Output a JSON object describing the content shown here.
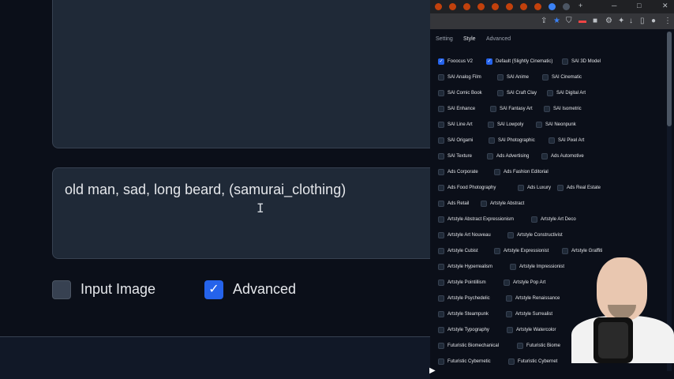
{
  "app": {
    "prompt_text": "old man, sad, long beard, (samurai_clothing)",
    "checkbox_input_image_label": "Input Image",
    "checkbox_advanced_label": "Advanced",
    "checkbox_input_image_checked": false,
    "checkbox_advanced_checked": true
  },
  "settings_tabs": [
    {
      "label": "Setting",
      "active": false
    },
    {
      "label": "Style",
      "active": true
    },
    {
      "label": "Advanced",
      "active": false
    }
  ],
  "styles": [
    {
      "label": "Fooocus V2",
      "checked": true
    },
    {
      "label": "Default (Slightly Cinematic)",
      "checked": true
    },
    {
      "label": "SAI 3D Model",
      "checked": false
    },
    {
      "label": "SAI Analog Film",
      "checked": false
    },
    {
      "label": "SAI Anime",
      "checked": false
    },
    {
      "label": "SAI Cinematic",
      "checked": false
    },
    {
      "label": "SAI Comic Book",
      "checked": false
    },
    {
      "label": "SAI Craft Clay",
      "checked": false
    },
    {
      "label": "SAI Digital Art",
      "checked": false
    },
    {
      "label": "SAI Enhance",
      "checked": false
    },
    {
      "label": "SAI Fantasy Art",
      "checked": false
    },
    {
      "label": "SAI Isometric",
      "checked": false
    },
    {
      "label": "SAI Line Art",
      "checked": false
    },
    {
      "label": "SAI Lowpoly",
      "checked": false
    },
    {
      "label": "SAI Neonpunk",
      "checked": false
    },
    {
      "label": "SAI Origami",
      "checked": false
    },
    {
      "label": "SAI Photographic",
      "checked": false
    },
    {
      "label": "SAI Pixel Art",
      "checked": false
    },
    {
      "label": "SAI Texture",
      "checked": false
    },
    {
      "label": "Ads Advertising",
      "checked": false
    },
    {
      "label": "Ads Automotive",
      "checked": false
    },
    {
      "label": "Ads Corporate",
      "checked": false
    },
    {
      "label": "Ads Fashion Editorial",
      "checked": false
    },
    {
      "label": "Ads Food Photography",
      "checked": false
    },
    {
      "label": "Ads Luxury",
      "checked": false
    },
    {
      "label": "Ads Real Estate",
      "checked": false
    },
    {
      "label": "Ads Retail",
      "checked": false
    },
    {
      "label": "Artstyle Abstract",
      "checked": false
    },
    {
      "label": "Artstyle Abstract Expressionism",
      "checked": false
    },
    {
      "label": "Artstyle Art Deco",
      "checked": false
    },
    {
      "label": "Artstyle Art Nouveau",
      "checked": false
    },
    {
      "label": "Artstyle Constructivist",
      "checked": false
    },
    {
      "label": "Artstyle Cubist",
      "checked": false
    },
    {
      "label": "Artstyle Expressionist",
      "checked": false
    },
    {
      "label": "Artstyle Graffiti",
      "checked": false
    },
    {
      "label": "Artstyle Hyperrealism",
      "checked": false
    },
    {
      "label": "Artstyle Impressionist",
      "checked": false
    },
    {
      "label": "Artstyle Pointillism",
      "checked": false
    },
    {
      "label": "Artstyle Pop Art",
      "checked": false
    },
    {
      "label": "Artstyle Psychedelic",
      "checked": false
    },
    {
      "label": "Artstyle Renaissance",
      "checked": false
    },
    {
      "label": "Artstyle Steampunk",
      "checked": false
    },
    {
      "label": "Artstyle Surrealist",
      "checked": false
    },
    {
      "label": "Artstyle Typography",
      "checked": false
    },
    {
      "label": "Artstyle Watercolor",
      "checked": false
    },
    {
      "label": "Futuristic Biomechanical",
      "checked": false
    },
    {
      "label": "Futuristic Biome",
      "checked": false
    },
    {
      "label": "Futuristic Cybernetic",
      "checked": false
    },
    {
      "label": "Futuristic Cybernet",
      "checked": false
    }
  ],
  "colors": {
    "accent": "#2563eb",
    "panel": "#1f2937",
    "background": "#0b0f19"
  },
  "icons": {
    "checkmark": "✓",
    "text_cursor": "I",
    "window_minimize": "─",
    "window_maximize": "□",
    "window_close": "✕",
    "new_tab": "+",
    "mouse_pointer": "▶"
  }
}
